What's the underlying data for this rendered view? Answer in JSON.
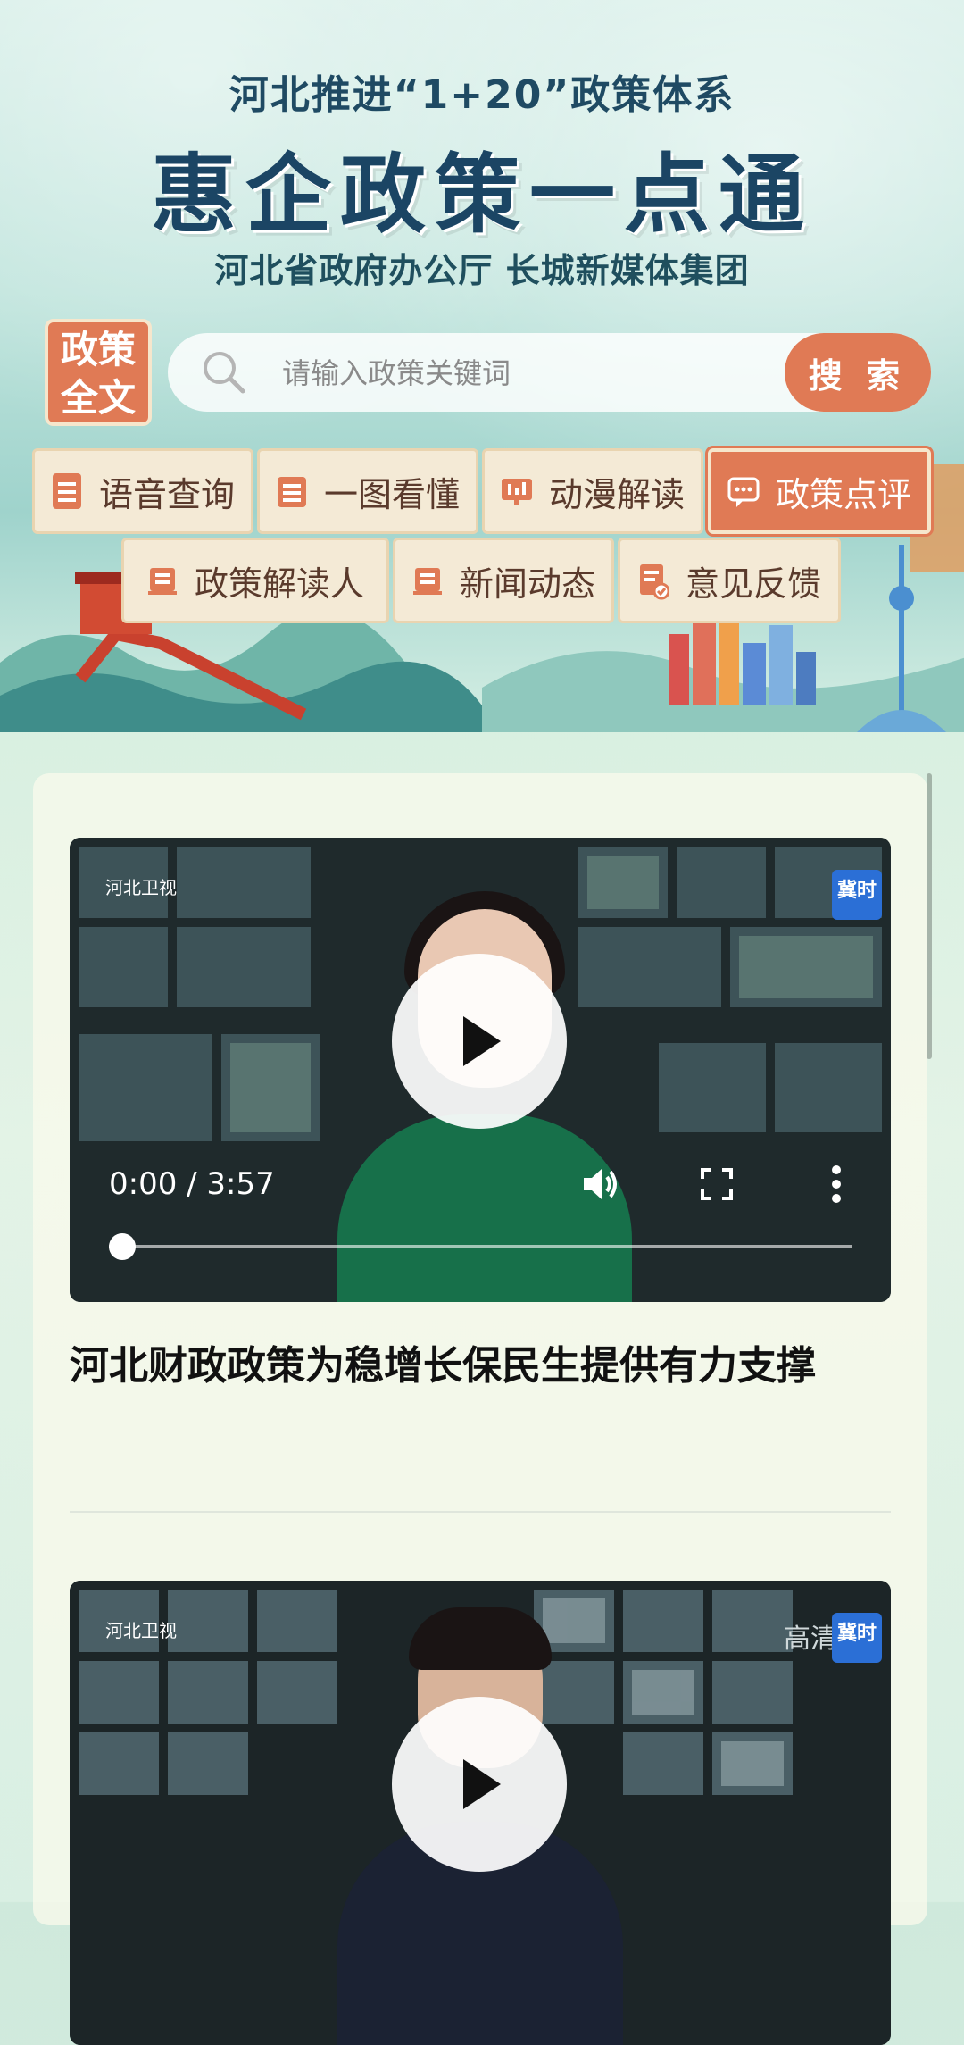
{
  "hero": {
    "subtitle": "河北推进“1+20”政策体系",
    "title": "惠企政策一点通",
    "organizers": "河北省政府办公厅  长城新媒体集团"
  },
  "policy_badge": {
    "line1": "政策",
    "line2": "全文"
  },
  "search": {
    "placeholder": "请输入政策关键词",
    "button_label": "搜 索"
  },
  "quick_actions": [
    {
      "label": "语音查询",
      "icon": "document-icon"
    },
    {
      "label": "一图看懂",
      "icon": "document-icon"
    },
    {
      "label": "动漫解读",
      "icon": "monitor-icon"
    },
    {
      "label": "政策点评",
      "icon": "chat-bubble-icon",
      "active": true
    },
    {
      "label": "政策解读人",
      "icon": "tray-icon"
    },
    {
      "label": "新闻动态",
      "icon": "tray-icon"
    },
    {
      "label": "意见反馈",
      "icon": "feedback-icon"
    }
  ],
  "videos": [
    {
      "channel_logo": "河北卫视",
      "corner_badge": "冀时",
      "time": "0:00 / 3:57",
      "progress": 0,
      "title": "河北财政政策为稳增长保民生提供有力支撑"
    },
    {
      "channel_logo": "河北卫视",
      "corner_badge": "冀时",
      "overlay_text": "高清"
    }
  ],
  "colors": {
    "accent": "#e07a55",
    "title_blue": "#1b4564",
    "button_bg": "#f4ead6"
  }
}
